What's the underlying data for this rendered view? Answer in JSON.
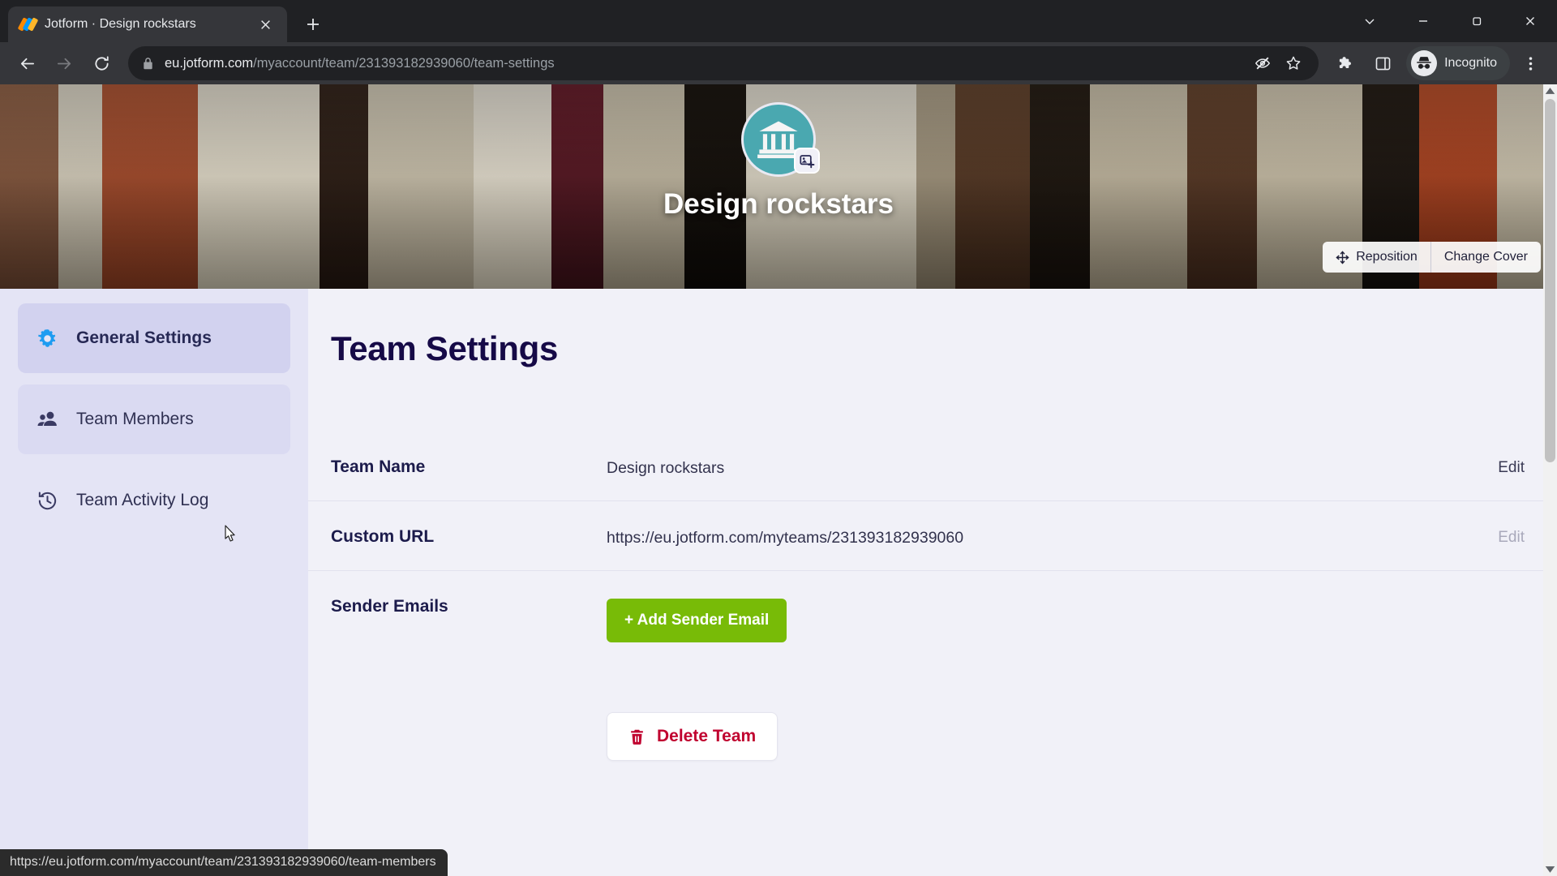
{
  "browser": {
    "tab": {
      "title": "Jotform · Design rockstars",
      "favicon": "jotform-logo-icon",
      "close_icon": "close-icon"
    },
    "new_tab_icon": "plus-icon",
    "window_controls": {
      "minimize_tabs_icon": "chevron-down-icon",
      "minimize_icon": "minimize-icon",
      "maximize_icon": "maximize-icon",
      "close_icon": "close-icon"
    },
    "nav": {
      "back_icon": "arrow-left-icon",
      "forward_icon": "arrow-right-icon",
      "reload_icon": "reload-icon"
    },
    "omnibox": {
      "lock_icon": "lock-icon",
      "url_host": "eu.jotform.com",
      "url_path": "/myaccount/team/231393182939060/team-settings",
      "full_url": "eu.jotform.com/myaccount/team/231393182939060/team-settings",
      "tracking_icon": "eye-slash-icon",
      "bookmark_icon": "star-icon"
    },
    "toolbar": {
      "extensions_icon": "puzzle-piece-icon",
      "sidepanel_icon": "side-panel-icon",
      "incognito_icon": "incognito-hat-glasses-icon",
      "incognito_label": "Incognito",
      "menu_icon": "three-dots-vertical-icon"
    },
    "status_bar_url": "https://eu.jotform.com/myaccount/team/231393182939060/team-members"
  },
  "cover": {
    "team_avatar_icon": "bank-building-icon",
    "avatar_badge_icon": "add-image-icon",
    "team_name": "Design rockstars",
    "reposition_icon": "move-arrows-icon",
    "reposition_label": "Reposition",
    "change_cover_label": "Change Cover",
    "avatar_bg_color": "#4aa8b0"
  },
  "sidebar": {
    "items": [
      {
        "label": "General Settings",
        "icon": "gear-icon",
        "state": "active"
      },
      {
        "label": "Team Members",
        "icon": "people-icon",
        "state": "hover"
      },
      {
        "label": "Team Activity Log",
        "icon": "clock-history-icon",
        "state": "default"
      }
    ]
  },
  "main": {
    "page_title": "Team Settings",
    "rows": [
      {
        "label": "Team Name",
        "value": "Design rockstars",
        "edit_label": "Edit",
        "edit_enabled": true
      },
      {
        "label": "Custom URL",
        "value": "https://eu.jotform.com/myteams/231393182939060",
        "edit_label": "Edit",
        "edit_enabled": false
      },
      {
        "label": "Sender Emails",
        "value": "",
        "button_label": "+ Add Sender Email",
        "edit_label": "",
        "edit_enabled": false
      }
    ],
    "delete_button": {
      "label": "Delete Team",
      "icon": "trash-icon",
      "color": "#c0022f"
    },
    "add_sender_email_color": "#78bb07"
  },
  "colors": {
    "sidebar_bg": "#e4e4f5",
    "sidebar_active": "#d2d2ef",
    "content_bg": "#f1f1f8",
    "title_color": "#160a47",
    "gear_blue": "#1e9cf1"
  }
}
